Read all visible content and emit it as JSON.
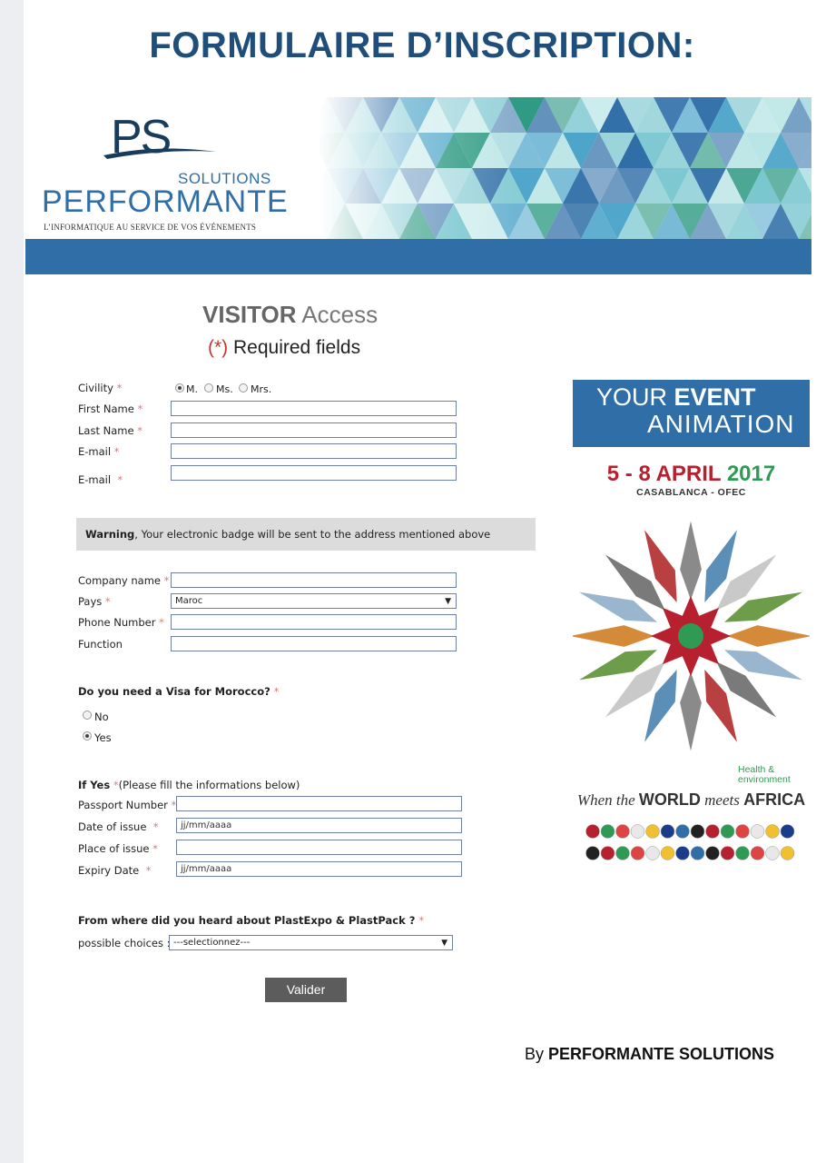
{
  "page": {
    "title": "FORMULAIRE D’INSCRIPTION:"
  },
  "banner": {
    "logo_mark": "PS",
    "logo_solutions": "SOLUTIONS",
    "logo_name": "PERFORMANTE",
    "logo_tagline": "L’INFORMATIQUE AU SERVICE DE VOS ÉVÉNEMENTS",
    "colors": {
      "bar": "#2f6ea7",
      "triangles": [
        "#2f6ea7",
        "#4aa3c9",
        "#79c6cf",
        "#b6e3e4",
        "#2e9a83"
      ]
    }
  },
  "form": {
    "heading_bold": "VISITOR",
    "heading_rest": " Access",
    "required_star": "(*)",
    "required_text": " Required fields",
    "civility": {
      "label": "Civility",
      "options": [
        {
          "label": "M.",
          "selected": true
        },
        {
          "label": "Ms.",
          "selected": false
        },
        {
          "label": "Mrs.",
          "selected": false
        }
      ]
    },
    "first_name": {
      "label": "First Name",
      "value": ""
    },
    "last_name": {
      "label": "Last Name",
      "value": ""
    },
    "email": {
      "label": "E-mail",
      "value": ""
    },
    "email_confirm": {
      "label": "E-mail",
      "value": ""
    },
    "required_mark": "*",
    "warning": {
      "bold": "Warning",
      "text": ", Your electronic badge will be sent to the address mentioned above"
    },
    "company_name": {
      "label": "Company name",
      "value": ""
    },
    "country": {
      "label": "Pays",
      "selected": "Maroc"
    },
    "phone": {
      "label": "Phone Number",
      "value": ""
    },
    "function": {
      "label": "Function",
      "value": ""
    },
    "visa": {
      "question": "Do you need a Visa for Morocco?",
      "options": [
        {
          "label": "No",
          "selected": false
        },
        {
          "label": "Yes",
          "selected": true
        }
      ]
    },
    "if_yes": {
      "title": "If Yes",
      "note": "(Please fill the informations below)"
    },
    "passport_number": {
      "label": "Passport Number",
      "value": ""
    },
    "date_of_issue": {
      "label": "Date of issue",
      "value": "jj/mm/aaaa"
    },
    "place_of_issue": {
      "label": "Place of issue",
      "value": ""
    },
    "expiry_date": {
      "label": "Expiry Date",
      "value": "jj/mm/aaaa"
    },
    "source": {
      "question": "From where did you heard about PlastExpo & PlastPack ?",
      "choices_label": "possible choices :",
      "selected": "---selectionnez---"
    },
    "submit_label": "Valider"
  },
  "ad": {
    "line1_normal": "YOUR ",
    "line1_bold": "EVENT",
    "line2": "ANIMATION",
    "dates": "5 - 8 APRIL ",
    "year": "2017",
    "venue": "CASABLANCA - OFEC",
    "health": "Health &",
    "environment": "environment",
    "slogan_pre": "When the ",
    "slogan_world": "WORLD",
    "slogan_meets": " meets ",
    "slogan_africa": "AFRICA",
    "colors": {
      "header": "#2f6ea7",
      "red": "#b7202e",
      "green": "#2e9a53"
    }
  },
  "footer": {
    "by": "By ",
    "company": "PERFORMANTE SOLUTIONS"
  }
}
